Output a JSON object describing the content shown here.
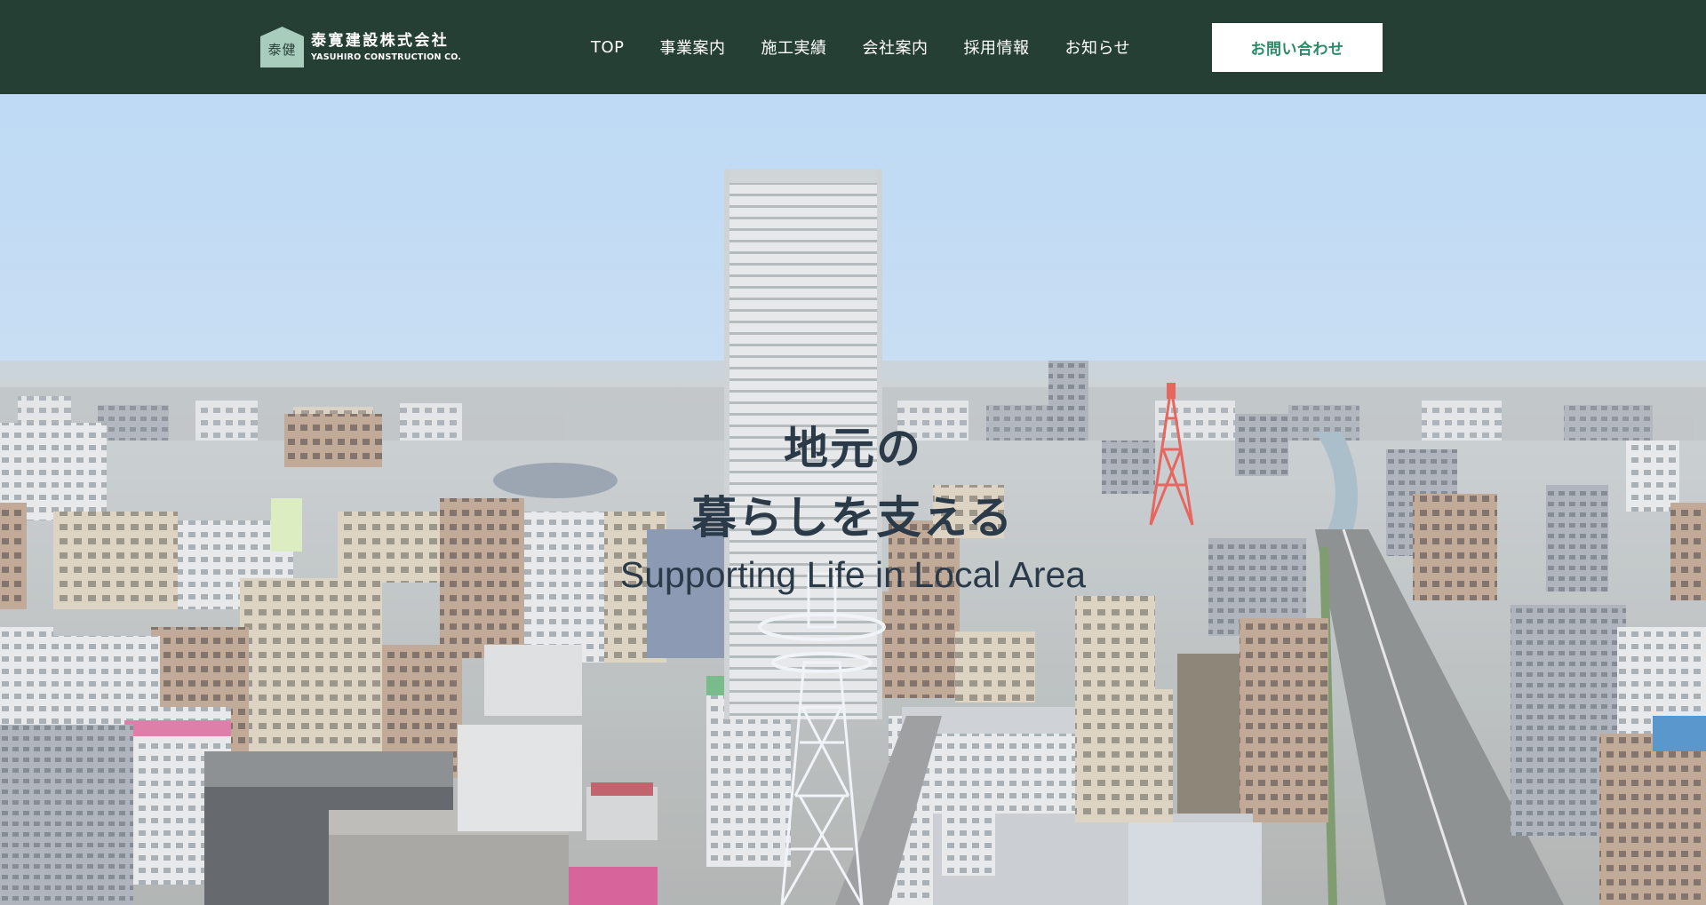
{
  "header": {
    "logo": {
      "mark_text": "泰健",
      "name_jp": "泰寛建設株式会社",
      "name_en": "YASUHIRO CONSTRUCTION CO."
    },
    "nav": [
      {
        "label": "TOP"
      },
      {
        "label": "事業案内"
      },
      {
        "label": "施工実績"
      },
      {
        "label": "会社案内"
      },
      {
        "label": "採用情報"
      },
      {
        "label": "お知らせ"
      }
    ],
    "contact_label": "お問い合わせ"
  },
  "hero": {
    "title_line1": "地元の",
    "title_line2": "暮らしを支える",
    "subtitle": "Supporting Life in Local Area",
    "image_description_icon": "city-skyline-photo"
  },
  "colors": {
    "header_bg": "#263f35",
    "accent": "#2b8a68",
    "logo_mark": "#a9cdbd",
    "hero_text": "#2b3a48"
  }
}
